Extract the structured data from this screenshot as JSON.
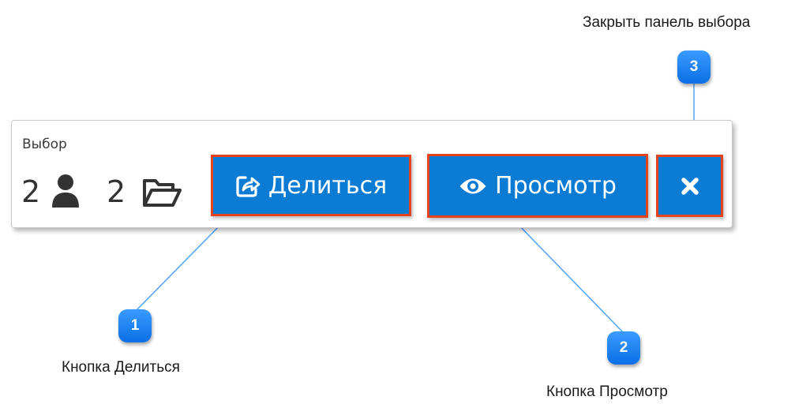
{
  "panel": {
    "title": "Выбор",
    "user_count": "2",
    "folder_count": "2",
    "icons": {
      "users": "user-icon",
      "folders": "folder-open-icon"
    }
  },
  "buttons": {
    "share": {
      "label": "Делиться",
      "icon": "share-icon"
    },
    "view": {
      "label": "Просмотр",
      "icon": "eye-icon"
    },
    "close": {
      "icon": "close-icon"
    }
  },
  "callouts": [
    {
      "number": "1",
      "text": "Кнопка Делиться"
    },
    {
      "number": "2",
      "text": "Кнопка Просмотр"
    },
    {
      "number": "3",
      "text": "Закрыть панель выбора"
    }
  ],
  "colors": {
    "button_bg": "#0c7bd4",
    "button_outline": "#e4431c",
    "badge_blue": "#1480f2",
    "connector": "#4da3ff"
  }
}
